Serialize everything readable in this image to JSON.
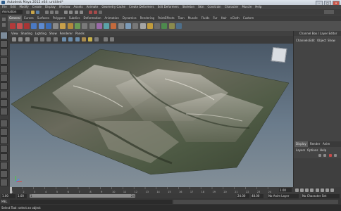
{
  "window": {
    "title": "Autodesk Maya 2012 x64: untitled*",
    "min": "–",
    "max": "□",
    "close": "×"
  },
  "menubar": {
    "items": [
      "File",
      "Edit",
      "Modify",
      "Create",
      "Display",
      "Window",
      "Assets",
      "Animate",
      "Geometry Cache",
      "Create Deformers",
      "Edit Deformers",
      "Skeleton",
      "Skin",
      "Constrain",
      "Character",
      "Muscle",
      "Help"
    ]
  },
  "modebar": {
    "mode": "Animation"
  },
  "shelf": {
    "tabs": [
      "General",
      "Curves",
      "Surfaces",
      "Polygons",
      "Subdivs",
      "Deformation",
      "Animation",
      "Dynamics",
      "Rendering",
      "PaintEffects",
      "Toon",
      "Muscle",
      "Fluids",
      "Fur",
      "Hair",
      "nCloth",
      "Custom"
    ],
    "active": 0
  },
  "viewport": {
    "menus": [
      "View",
      "Shading",
      "Lighting",
      "Show",
      "Renderer",
      "Panels"
    ]
  },
  "channelbox": {
    "header": "Channel Box / Layer Editor",
    "tabs": [
      "Channels",
      "Edit",
      "Object",
      "Show"
    ]
  },
  "layers": {
    "tabs": [
      "Display",
      "Render",
      "Anim"
    ],
    "menus": [
      "Layers",
      "Options",
      "Help"
    ]
  },
  "timeline": {
    "ticks": [
      "1",
      "2",
      "3",
      "4",
      "5",
      "6",
      "7",
      "8",
      "9",
      "10",
      "11",
      "12",
      "13",
      "14",
      "15",
      "16",
      "17",
      "18",
      "19",
      "20",
      "21",
      "22",
      "23",
      "24"
    ],
    "current": "1.00"
  },
  "range": {
    "start": "1.00",
    "inner_start": "1.00",
    "inner_end": "24.00",
    "end": "48.00",
    "frame_marker": "1",
    "end_marker": "24",
    "anim_layer": "No Anim Layer",
    "char_set": "No Character Set"
  },
  "mel": {
    "label": "MEL"
  },
  "helpline": {
    "text": "Select Tool: select an object"
  },
  "colors": {
    "accent": "#c8574a",
    "viewport_top": "#4a5867",
    "viewport_bottom": "#838f98"
  }
}
